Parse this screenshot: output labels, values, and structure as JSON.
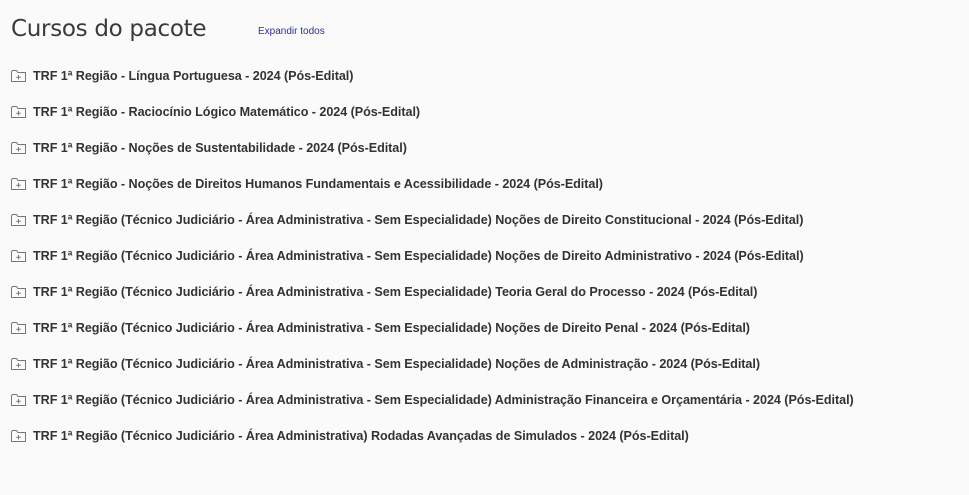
{
  "header": {
    "title": "Cursos do pacote",
    "expand_all_label": "Expandir todos"
  },
  "icons": {
    "folder": "folder-plus-icon"
  },
  "colors": {
    "title": "#3a3a3a",
    "link": "#2a2f9c",
    "text": "#333333",
    "background": "#fafafa"
  },
  "courses": [
    {
      "label": "TRF 1ª Região - Língua Portuguesa - 2024 (Pós-Edital)"
    },
    {
      "label": "TRF 1ª Região - Raciocínio Lógico Matemático - 2024 (Pós-Edital)"
    },
    {
      "label": "TRF 1ª Região - Noções de Sustentabilidade - 2024 (Pós-Edital)"
    },
    {
      "label": "TRF 1ª Região - Noções de Direitos Humanos Fundamentais e Acessibilidade - 2024 (Pós-Edital)"
    },
    {
      "label": "TRF 1ª Região (Técnico Judiciário - Área Administrativa - Sem Especialidade) Noções de Direito Constitucional - 2024 (Pós-Edital)"
    },
    {
      "label": "TRF 1ª Região (Técnico Judiciário - Área Administrativa - Sem Especialidade) Noções de Direito Administrativo - 2024 (Pós-Edital)"
    },
    {
      "label": "TRF 1ª Região (Técnico Judiciário - Área Administrativa - Sem Especialidade) Teoria Geral do Processo - 2024 (Pós-Edital)"
    },
    {
      "label": "TRF 1ª Região (Técnico Judiciário - Área Administrativa - Sem Especialidade) Noções de Direito Penal - 2024 (Pós-Edital)"
    },
    {
      "label": "TRF 1ª Região (Técnico Judiciário - Área Administrativa - Sem Especialidade) Noções de Administração - 2024 (Pós-Edital)"
    },
    {
      "label": "TRF 1ª Região (Técnico Judiciário - Área Administrativa - Sem Especialidade) Administração Financeira e Orçamentária - 2024 (Pós-Edital)"
    },
    {
      "label": "TRF 1ª Região (Técnico Judiciário - Área Administrativa) Rodadas Avançadas de Simulados - 2024 (Pós-Edital)"
    }
  ]
}
